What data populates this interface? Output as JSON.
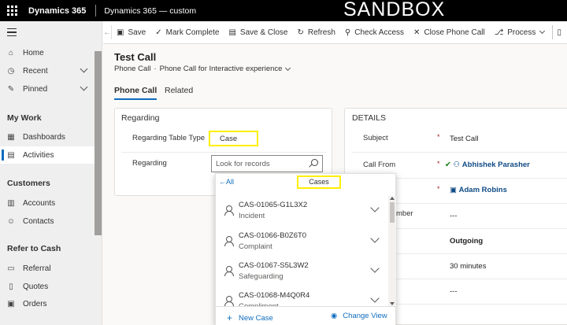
{
  "topbar": {
    "app_name": "Dynamics 365",
    "env_name": "Dynamics 365 — custom",
    "banner": "SANDBOX"
  },
  "nav": {
    "home": "Home",
    "recent": "Recent",
    "pinned": "Pinned",
    "group_mywork": "My Work",
    "dashboards": "Dashboards",
    "activities": "Activities",
    "group_customers": "Customers",
    "accounts": "Accounts",
    "contacts": "Contacts",
    "group_refer": "Refer to Cash",
    "referral": "Referral",
    "quotes": "Quotes",
    "orders": "Orders"
  },
  "commands": {
    "save": "Save",
    "mark_complete": "Mark Complete",
    "save_close": "Save & Close",
    "refresh": "Refresh",
    "check_access": "Check Access",
    "close_phone_call": "Close Phone Call",
    "process": "Process"
  },
  "header": {
    "title": "Test Call",
    "entity": "Phone Call",
    "form": "Phone Call for Interactive experience"
  },
  "tabs": {
    "phone_call": "Phone Call",
    "related": "Related"
  },
  "regarding": {
    "section": "Regarding",
    "table_type_label": "Regarding Table Type",
    "table_type_value": "Case",
    "regarding_label": "Regarding",
    "lookup_placeholder": "Look for records"
  },
  "details": {
    "section": "DETAILS",
    "subject_label": "Subject",
    "subject_value": "Test Call",
    "call_from_label": "Call From",
    "call_from_value": "Abhishek Parasher",
    "call_to_value": "Adam Robins",
    "phone_label_partial": "mber",
    "phone_value": "---",
    "direction_value": "Outgoing",
    "duration_value": "30 minutes",
    "extra_value": "---"
  },
  "flyout": {
    "all_link": "All",
    "cases_tag": "Cases",
    "records": [
      {
        "number": "CAS-01065-G1L3X2",
        "type": "Incident"
      },
      {
        "number": "CAS-01066-B0Z6T0",
        "type": "Complaint"
      },
      {
        "number": "CAS-01067-S5L3W2",
        "type": "Safeguarding"
      },
      {
        "number": "CAS-01068-M4Q0R4",
        "type": "Compliment"
      }
    ],
    "new_case": "New Case",
    "change_view": "Change View"
  }
}
